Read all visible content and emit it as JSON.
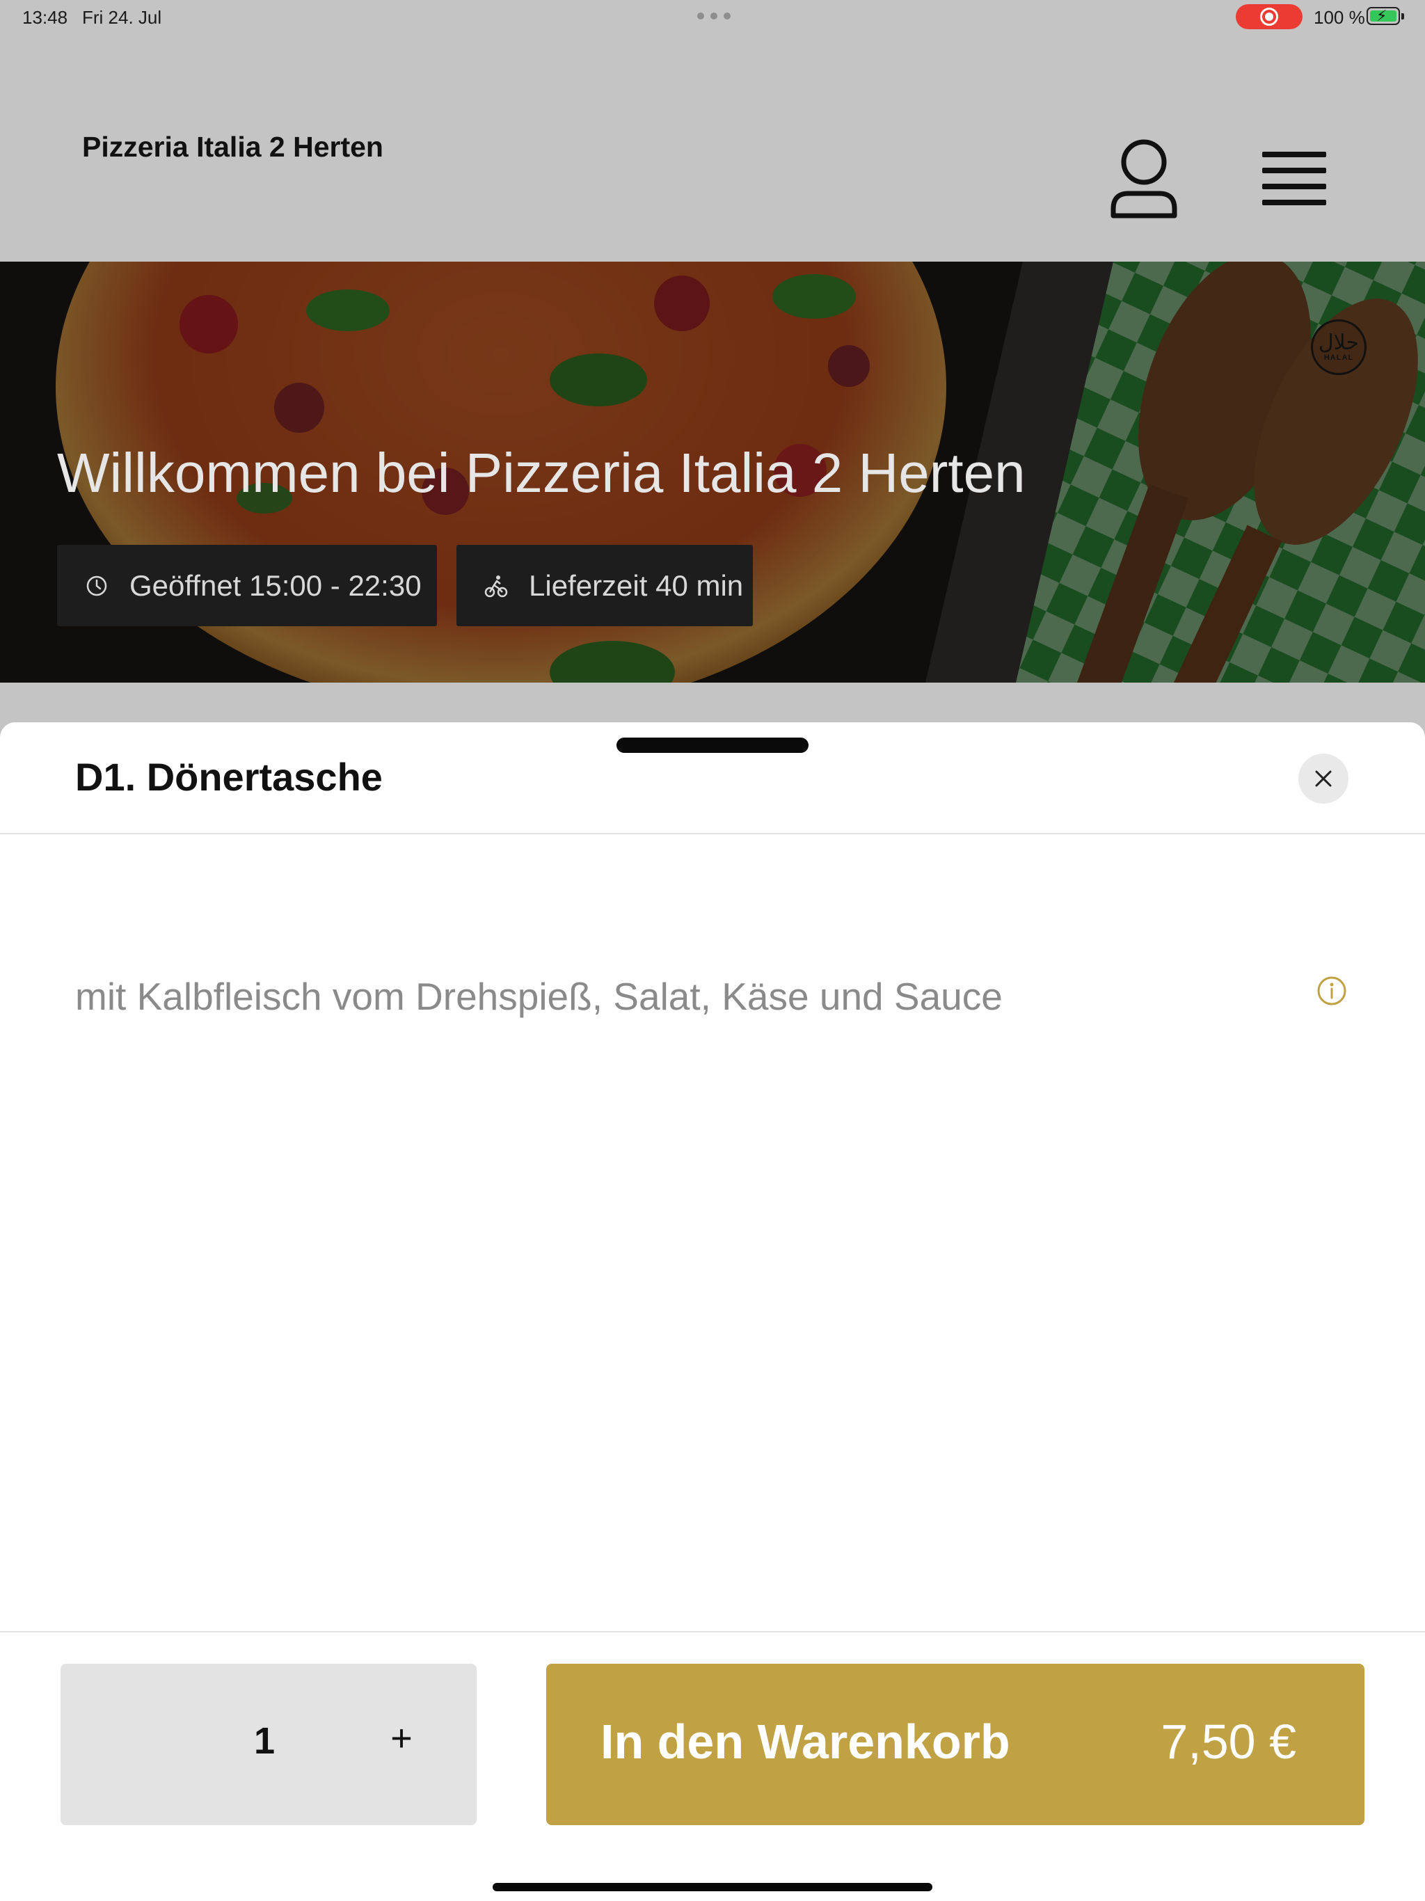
{
  "status_bar": {
    "time": "13:48",
    "date": "Fri 24. Jul",
    "battery": "100 %",
    "icons": [
      "multitasking-dots-icon",
      "screen-record-icon",
      "battery-charging-icon"
    ]
  },
  "header": {
    "title": "Pizzeria Italia 2 Herten",
    "icons": [
      "user-icon",
      "hamburger-menu-icon"
    ]
  },
  "hero": {
    "title": "Willkommen bei Pizzeria Italia 2 Herten",
    "hours": "Geöffnet 15:00 - 22:30",
    "delivery": "Lieferzeit 40 min",
    "halal_arabic": "حلال",
    "halal_text": "HALAL",
    "icons": [
      "clock-icon",
      "cyclist-icon",
      "halal-icon"
    ]
  },
  "product": {
    "title": "D1. Dönertasche",
    "description": "mit Kalbfleisch vom Drehspieß, Salat, Käse und Sauce",
    "icons": [
      "close-icon",
      "info-icon"
    ]
  },
  "footer": {
    "quantity": "1",
    "plus": "+",
    "cart_label": "In den Warenkorb",
    "price": "7,50 €"
  },
  "colors": {
    "accent": "#c0a144",
    "page_background": "#c4c4c4",
    "record_indicator": "#ec3b33",
    "battery": "#35c759"
  }
}
